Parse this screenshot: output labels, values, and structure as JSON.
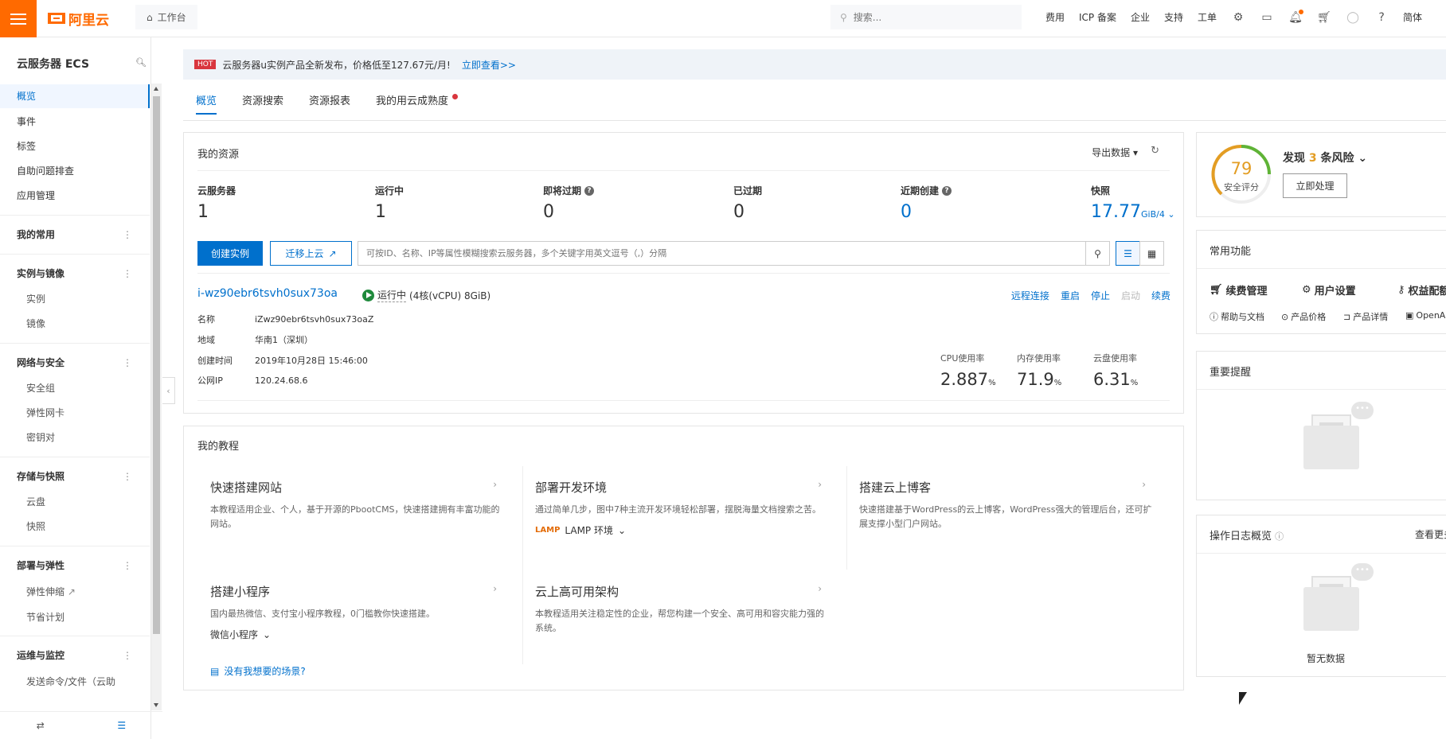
{
  "topbar": {
    "logo": "阿里云",
    "workspace": "工作台",
    "search_placeholder": "搜索...",
    "links": [
      "费用",
      "ICP 备案",
      "企业",
      "支持",
      "工单"
    ],
    "language": "简体"
  },
  "sidebar": {
    "title": "云服务器 ECS",
    "top_items": [
      "概览",
      "事件",
      "标签",
      "自助问题排查",
      "应用管理"
    ],
    "groups": [
      {
        "label": "我的常用",
        "items": []
      },
      {
        "label": "实例与镜像",
        "items": [
          "实例",
          "镜像"
        ]
      },
      {
        "label": "网络与安全",
        "items": [
          "安全组",
          "弹性网卡",
          "密钥对"
        ]
      },
      {
        "label": "存储与快照",
        "items": [
          "云盘",
          "快照"
        ]
      },
      {
        "label": "部署与弹性",
        "items": [
          "弹性伸缩",
          "节省计划"
        ]
      },
      {
        "label": "运维与监控",
        "items": [
          "发送命令/文件（云助"
        ]
      }
    ]
  },
  "notice": {
    "badge": "HOT",
    "text": "云服务器u实例产品全新发布，价格低至127.67元/月!",
    "link": "立即查看>>"
  },
  "tabs": [
    "概览",
    "资源搜索",
    "资源报表",
    "我的用云成熟度"
  ],
  "resources": {
    "title": "我的资源",
    "export": "导出数据",
    "stats": [
      {
        "label": "云服务器",
        "value": "1"
      },
      {
        "label": "运行中",
        "value": "1"
      },
      {
        "label": "即将过期",
        "value": "0"
      },
      {
        "label": "已过期",
        "value": "0"
      },
      {
        "label": "近期创建",
        "value": "0"
      },
      {
        "label": "快照",
        "value": "17.77",
        "unit": "GiB/4"
      }
    ],
    "create_button": "创建实例",
    "migrate_button": "迁移上云",
    "filter_placeholder": "可按ID、名称、IP等属性模糊搜索云服务器，多个关键字用英文逗号（,）分隔",
    "instance": {
      "id": "i-wz90ebr6tsvh0sux73oa",
      "status": "运行中",
      "spec": "(4核(vCPU) 8GiB)",
      "actions": [
        "远程连接",
        "重启",
        "停止",
        "启动",
        "续费"
      ],
      "fields": [
        {
          "k": "名称",
          "v": "iZwz90ebr6tsvh0sux73oaZ"
        },
        {
          "k": "地域",
          "v": "华南1（深圳）"
        },
        {
          "k": "创建时间",
          "v": "2019年10月28日 15:46:00"
        },
        {
          "k": "公网IP",
          "v": "120.24.68.6"
        }
      ],
      "metrics": [
        {
          "label": "CPU使用率",
          "value": "2.887",
          "unit": "%"
        },
        {
          "label": "内存使用率",
          "value": "71.9",
          "unit": "%"
        },
        {
          "label": "云盘使用率",
          "value": "6.31",
          "unit": "%"
        }
      ]
    }
  },
  "tutorials": {
    "title": "我的教程",
    "items": [
      {
        "title": "快速搭建网站",
        "desc": "本教程适用企业、个人，基于开源的PbootCMS，快速搭建拥有丰富功能的网站。"
      },
      {
        "title": "部署开发环境",
        "desc": "通过简单几步，图中7种主流开发环境轻松部署，摆脱海量文档搜索之苦。",
        "select": "LAMP 环境"
      },
      {
        "title": "搭建云上博客",
        "desc": "快速搭建基于WordPress的云上博客，WordPress强大的管理后台，还可扩展支撑小型门户网站。"
      },
      {
        "title": "搭建小程序",
        "desc": "国内最热微信、支付宝小程序教程，0门槛教你快速搭建。",
        "select": "微信小程序"
      },
      {
        "title": "云上高可用架构",
        "desc": "本教程适用关注稳定性的企业，帮您构建一个安全、高可用和容灾能力强的系统。"
      }
    ],
    "no_scene": "没有我想要的场景?"
  },
  "security": {
    "score": "79",
    "score_label": "安全评分",
    "risk_prefix": "发现",
    "risk_count": "3",
    "risk_suffix": "条风险",
    "handle_button": "立即处理"
  },
  "common_functions": {
    "title": "常用功能",
    "main": [
      "续费管理",
      "用户设置",
      "权益配额"
    ],
    "links": [
      "帮助与文档",
      "产品价格",
      "产品详情",
      "OpenAPI"
    ]
  },
  "reminders": {
    "title": "重要提醒"
  },
  "oplog": {
    "title": "操作日志概览",
    "more": "查看更多",
    "empty": "暂无数据"
  },
  "colors": {
    "brand": "#ff6a00",
    "primary": "#0070cc",
    "score": "#e39d23"
  }
}
